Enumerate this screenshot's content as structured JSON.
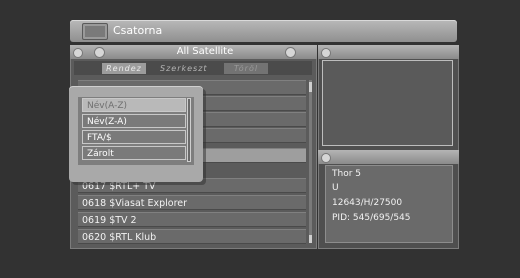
{
  "header": {
    "title": "Csatorna",
    "tv_icon": "tv-icon"
  },
  "channel_list": {
    "title": "All Satellite",
    "tabs": [
      "Rendez",
      "Szerkeszt",
      "Töröl"
    ],
    "rows": [
      "",
      "",
      "",
      "",
      "",
      "0617 $RTL+ TV",
      "0618 $Viasat Explorer",
      "0619 $TV 2",
      "0620 $RTL Klub"
    ]
  },
  "sort_popup": {
    "items": [
      "Név(A-Z)",
      "Név(Z-A)",
      "FTA/$",
      "Zárolt"
    ],
    "selected_index": 0
  },
  "channel_info": {
    "satellite": "Thor 5",
    "polarization": "U",
    "transponder": "12643/H/27500",
    "pid": "PID: 545/695/545"
  }
}
